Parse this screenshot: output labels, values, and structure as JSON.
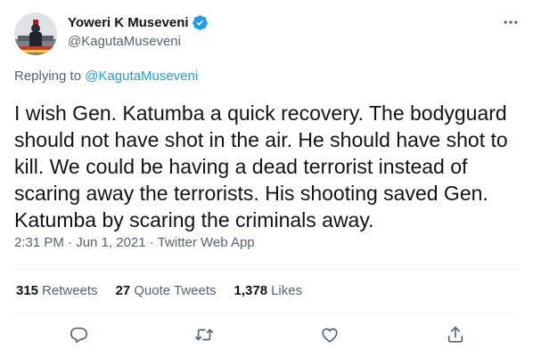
{
  "author": {
    "name": "Yoweri K Museveni",
    "handle": "@KagutaMuseveni"
  },
  "reply": {
    "prefix": "Replying to",
    "to": "@KagutaMuseveni"
  },
  "tweet": {
    "text": "I wish Gen. Katumba a quick recovery. The bodyguard should not have shot in the air. He should have shot to kill. We could be having a dead terrorist instead of scaring away the terrorists. His shooting saved Gen. Katumba by scaring the criminals away."
  },
  "meta": {
    "time": "2:31 PM",
    "date": "Jun 1, 2021",
    "source": "Twitter Web App"
  },
  "stats": {
    "retweets": {
      "count": "315",
      "label": "Retweets"
    },
    "quotes": {
      "count": "27",
      "label": "Quote Tweets"
    },
    "likes": {
      "count": "1,378",
      "label": "Likes"
    }
  },
  "icons": {
    "verified": "verified-badge-icon",
    "more": "more-dots-icon",
    "reply": "reply-icon",
    "retweet": "retweet-icon",
    "like": "heart-icon",
    "share": "share-icon"
  },
  "colors": {
    "accent": "#1d9bf0",
    "secondary_text": "#536471",
    "primary_text": "#0f1419",
    "divider": "#eff3f4"
  }
}
